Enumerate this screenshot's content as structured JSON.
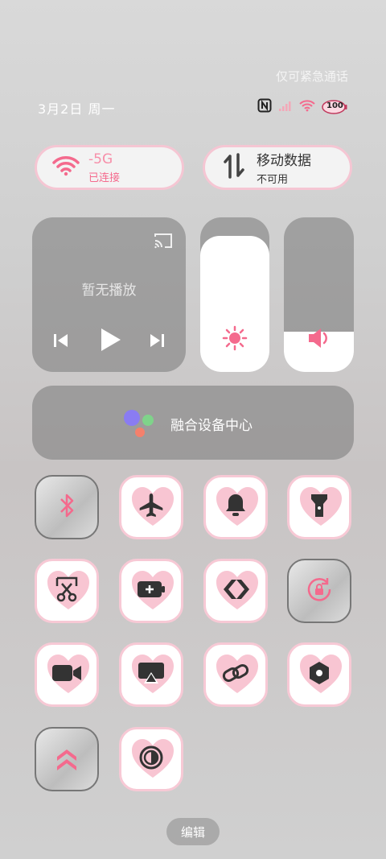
{
  "status_bar": {
    "emergency_text": "仅可紧急通话",
    "date_text": "3月2日 周一",
    "battery_text": "100",
    "icons": [
      "nfc-icon",
      "signal-icon",
      "wifi-icon",
      "battery-icon"
    ]
  },
  "wifi": {
    "label": "-5G",
    "sublabel": "已连接",
    "accent": "#f46a8d"
  },
  "mobile_data": {
    "label": "移动数据",
    "sublabel": "不可用"
  },
  "media": {
    "title": "暂无播放"
  },
  "brightness": {
    "level": 0.88
  },
  "volume": {
    "level": 0.26
  },
  "fusion": {
    "label": "融合设备中心"
  },
  "toggles": [
    {
      "name": "bluetooth",
      "icon": "bluetooth-icon",
      "state": "photo"
    },
    {
      "name": "airplane-mode",
      "icon": "airplane-icon",
      "state": "white"
    },
    {
      "name": "ring",
      "icon": "bell-icon",
      "state": "white"
    },
    {
      "name": "flashlight",
      "icon": "flashlight-icon",
      "state": "white"
    },
    {
      "name": "screenshot",
      "icon": "scissors-icon",
      "state": "white"
    },
    {
      "name": "battery-saver",
      "icon": "battery-plus-icon",
      "state": "white"
    },
    {
      "name": "dual-link",
      "icon": "dual-arrow-icon",
      "state": "white"
    },
    {
      "name": "rotation-lock",
      "icon": "rotation-lock-icon",
      "state": "photo"
    },
    {
      "name": "screen-record",
      "icon": "video-camera-icon",
      "state": "white"
    },
    {
      "name": "screen-cast",
      "icon": "cast-screen-icon",
      "state": "white"
    },
    {
      "name": "link",
      "icon": "link-icon",
      "state": "white"
    },
    {
      "name": "hotspot",
      "icon": "hexagon-icon",
      "state": "white"
    },
    {
      "name": "performance",
      "icon": "double-chevron-up-icon",
      "state": "photo"
    },
    {
      "name": "dark-mode",
      "icon": "contrast-icon",
      "state": "white"
    }
  ],
  "edit": {
    "label": "编辑"
  },
  "colors": {
    "pink": "#f46a8d",
    "heart": "#f8c5d2",
    "icon_dark": "#333333"
  }
}
